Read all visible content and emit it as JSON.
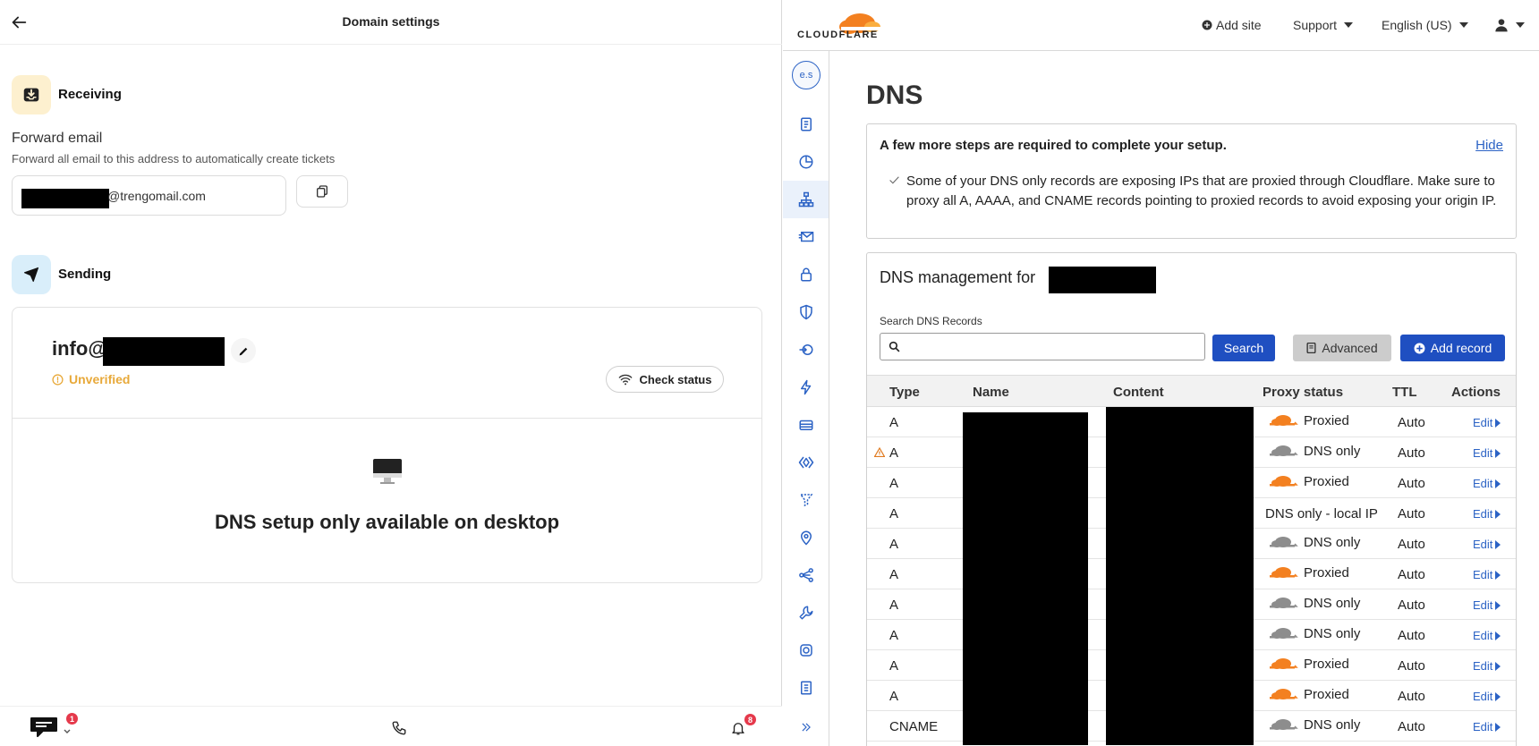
{
  "left": {
    "title": "Domain settings",
    "receiving": {
      "label": "Receiving",
      "forward_title": "Forward email",
      "forward_desc": "Forward all email to this address to automatically create tickets",
      "email_domain": "@trengomail.com"
    },
    "sending": {
      "label": "Sending",
      "address_prefix": "info@",
      "status": "Unverified",
      "check_status_label": "Check status",
      "desktop_msg": "DNS setup only available on desktop"
    },
    "footer": {
      "inbox_badge": "1",
      "notif_badge": "8"
    }
  },
  "right": {
    "logo_text": "CLOUDFLARE",
    "nav": {
      "add_site": "Add site",
      "support": "Support",
      "language": "English (US)"
    },
    "account_initials": "e.s",
    "page_title": "DNS",
    "setup": {
      "heading": "A few more steps are required to complete your setup.",
      "hide": "Hide",
      "message": "Some of your DNS only records are exposing IPs that are proxied through Cloudflare. Make sure to proxy all A, AAAA, and CNAME records pointing to proxied records to avoid exposing your origin IP."
    },
    "management": {
      "title": "DNS management for",
      "search_label": "Search DNS Records",
      "search_placeholder": "",
      "search_button": "Search",
      "advanced_button": "Advanced",
      "add_record_button": "Add record"
    },
    "table": {
      "headers": [
        "Type",
        "Name",
        "Content",
        "Proxy status",
        "TTL",
        "Actions"
      ],
      "rows": [
        {
          "type": "A",
          "proxy": "Proxied",
          "cloud": "orange",
          "ttl": "Auto",
          "action": "Edit",
          "warn": false
        },
        {
          "type": "A",
          "proxy": "DNS only",
          "cloud": "gray",
          "ttl": "Auto",
          "action": "Edit",
          "warn": true
        },
        {
          "type": "A",
          "proxy": "Proxied",
          "cloud": "orange",
          "ttl": "Auto",
          "action": "Edit",
          "warn": false
        },
        {
          "type": "A",
          "proxy": "DNS only - local IP",
          "cloud": "none",
          "ttl": "Auto",
          "action": "Edit",
          "warn": false
        },
        {
          "type": "A",
          "proxy": "DNS only",
          "cloud": "gray",
          "ttl": "Auto",
          "action": "Edit",
          "warn": false
        },
        {
          "type": "A",
          "proxy": "Proxied",
          "cloud": "orange",
          "ttl": "Auto",
          "action": "Edit",
          "warn": false
        },
        {
          "type": "A",
          "proxy": "DNS only",
          "cloud": "gray",
          "ttl": "Auto",
          "action": "Edit",
          "warn": false
        },
        {
          "type": "A",
          "proxy": "DNS only",
          "cloud": "gray",
          "ttl": "Auto",
          "action": "Edit",
          "warn": false
        },
        {
          "type": "A",
          "proxy": "Proxied",
          "cloud": "orange",
          "ttl": "Auto",
          "action": "Edit",
          "warn": false
        },
        {
          "type": "A",
          "proxy": "Proxied",
          "cloud": "orange",
          "ttl": "Auto",
          "action": "Edit",
          "warn": false
        },
        {
          "type": "CNAME",
          "proxy": "DNS only",
          "cloud": "gray",
          "ttl": "Auto",
          "action": "Edit",
          "warn": false
        }
      ]
    },
    "sidebar_icons": [
      "overview-icon",
      "analytics-icon",
      "dns-icon",
      "email-icon",
      "ssl-lock-icon",
      "security-shield-icon",
      "access-icon",
      "speed-bolt-icon",
      "caching-icon",
      "workers-icon",
      "rules-icon",
      "network-pin-icon",
      "traffic-icon",
      "custom-pages-icon",
      "apps-icon",
      "scrape-shield-icon"
    ]
  },
  "colors": {
    "cf_blue": "#1f4fc1",
    "cf_orange": "#f38020",
    "unverified": "#e8a93a",
    "badge": "#e5394b"
  }
}
